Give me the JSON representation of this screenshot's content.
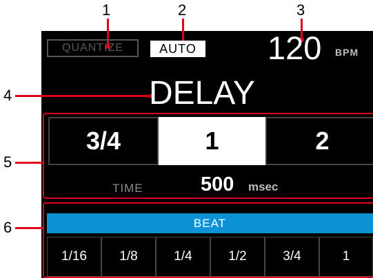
{
  "callouts": [
    "1",
    "2",
    "3",
    "4",
    "5",
    "6"
  ],
  "status": {
    "quantize_label": "QUANTIZE",
    "auto_label": "AUTO",
    "bpm_value": "120",
    "bpm_unit": "BPM"
  },
  "effect": {
    "name": "DELAY"
  },
  "beat_select": {
    "items": [
      "3/4",
      "1",
      "2"
    ],
    "selected_index": 1
  },
  "time": {
    "label": "TIME",
    "value": "500",
    "unit": "msec"
  },
  "beat_panel": {
    "header": "BEAT",
    "cells": [
      "1/16",
      "1/8",
      "1/4",
      "1/2",
      "3/4",
      "1"
    ]
  },
  "colors": {
    "callout": "#e0001b",
    "beat_header": "#0d92d6",
    "screen": "#000000"
  }
}
